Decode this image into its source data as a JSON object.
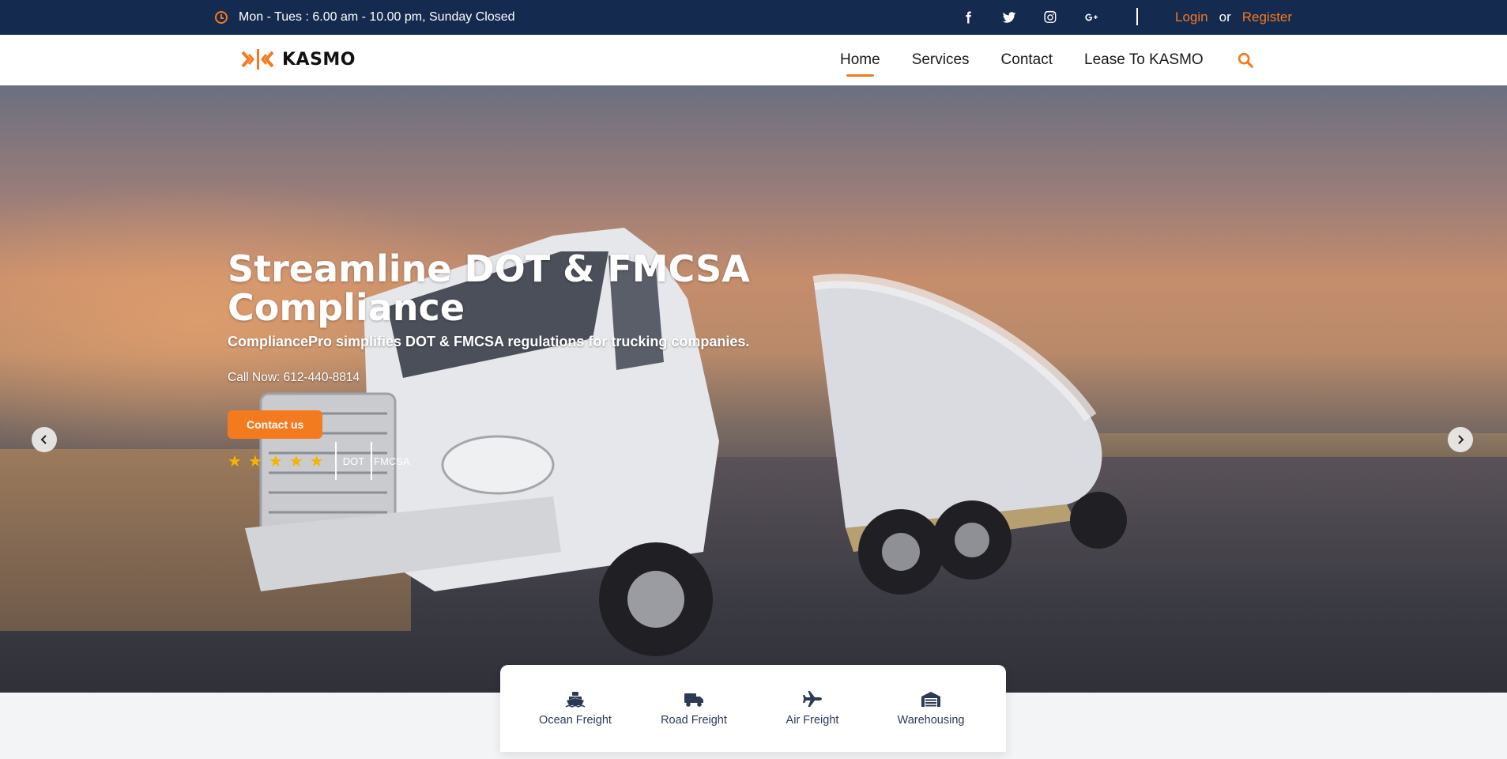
{
  "topbar": {
    "hours": "Mon - Tues : 6.00 am - 10.00 pm, Sunday Closed",
    "social_icons": [
      "facebook-icon",
      "twitter-icon",
      "instagram-icon",
      "google-plus-icon"
    ],
    "login": "Login",
    "or": "or",
    "register": "Register"
  },
  "nav": {
    "logo_text": "KASMO",
    "links": [
      "Home",
      "Services",
      "Contact",
      "Lease To KASMO"
    ],
    "active": "Home",
    "search_icon": "search-icon"
  },
  "hero": {
    "title_line1": "Streamline DOT & FMCSA",
    "title_line2": "Compliance",
    "subtitle": "CompliancePro simplifies DOT & FMCSA regulations for trucking companies.",
    "call": "Call Now: 612-440-8814",
    "cta": "Contact us",
    "stars": [
      "★",
      "★",
      "★",
      "★",
      "★"
    ],
    "rating": 5,
    "badges": [
      "DOT",
      "FMCSA"
    ]
  },
  "services": [
    {
      "label": "Ocean Freight",
      "icon": "ship-icon"
    },
    {
      "label": "Road Freight",
      "icon": "truck-icon"
    },
    {
      "label": "Air Freight",
      "icon": "plane-icon"
    },
    {
      "label": "Warehousing",
      "icon": "warehouse-icon"
    }
  ],
  "colors": {
    "topbar_bg": "#152a4f",
    "accent": "#f47a20",
    "star": "#f5b400",
    "service_text": "#2b3a55"
  }
}
